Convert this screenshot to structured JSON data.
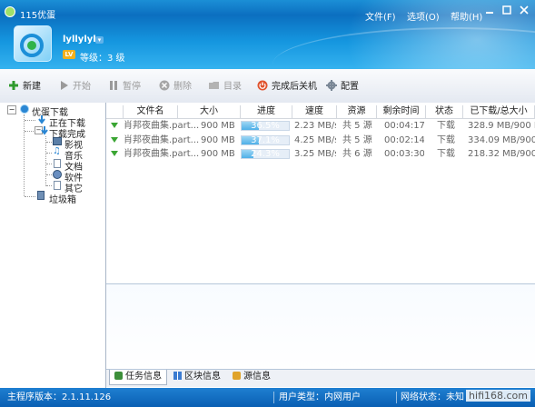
{
  "app": {
    "title": "115优蛋"
  },
  "menu": {
    "file": "文件(F)",
    "options": "选项(O)",
    "help": "帮助(H)"
  },
  "user": {
    "name": "lyllylyl",
    "level_badge": "LV",
    "level_text": "等级：3 级"
  },
  "toolbar": {
    "new": "新建",
    "start": "开始",
    "pause": "暂停",
    "delete": "删除",
    "folder": "目录",
    "shutdown": "完成后关机",
    "config": "配置"
  },
  "tree": {
    "root": "优蛋下载",
    "downloading": "正在下载",
    "completed": "下载完成",
    "video": "影视",
    "music": "音乐",
    "docs": "文档",
    "software": "软件",
    "other": "其它",
    "trash": "垃圾箱"
  },
  "table": {
    "headers": [
      "文件名",
      "大小",
      "进度",
      "速度",
      "资源",
      "剩余时间",
      "状态",
      "已下载/总大小"
    ],
    "rows": [
      {
        "name": "肖邦夜曲集.part...",
        "size": "900 MB",
        "progress": 36.5,
        "progress_text": "36.5%",
        "speed": "2.23 MB/s",
        "sources": "共 5 源",
        "remaining": "00:04:17",
        "status": "下载",
        "downloaded": "328.9 MB/900 MB"
      },
      {
        "name": "肖邦夜曲集.part...",
        "size": "900 MB",
        "progress": 37.1,
        "progress_text": "37.1%",
        "speed": "4.25 MB/s",
        "sources": "共 5 源",
        "remaining": "00:02:14",
        "status": "下载",
        "downloaded": "334.09 MB/900 MB"
      },
      {
        "name": "肖邦夜曲集.part...",
        "size": "900 MB",
        "progress": 24.3,
        "progress_text": "24.3%",
        "speed": "3.25 MB/s",
        "sources": "共 6 源",
        "remaining": "00:03:30",
        "status": "下载",
        "downloaded": "218.32 MB/900 MB"
      }
    ]
  },
  "tabs": {
    "task": "任务信息",
    "block": "区块信息",
    "source": "源信息"
  },
  "status": {
    "version": "主程序版本：2.1.11.126",
    "user_type": "用户类型：内网用户",
    "network": "网络状态：未知"
  },
  "watermark": "hifi168.com",
  "colors": {
    "header": "#1596df",
    "statusbar": "#0a5fb3",
    "progress": "#4fb0e8",
    "download_arrow": "#3aa533"
  }
}
